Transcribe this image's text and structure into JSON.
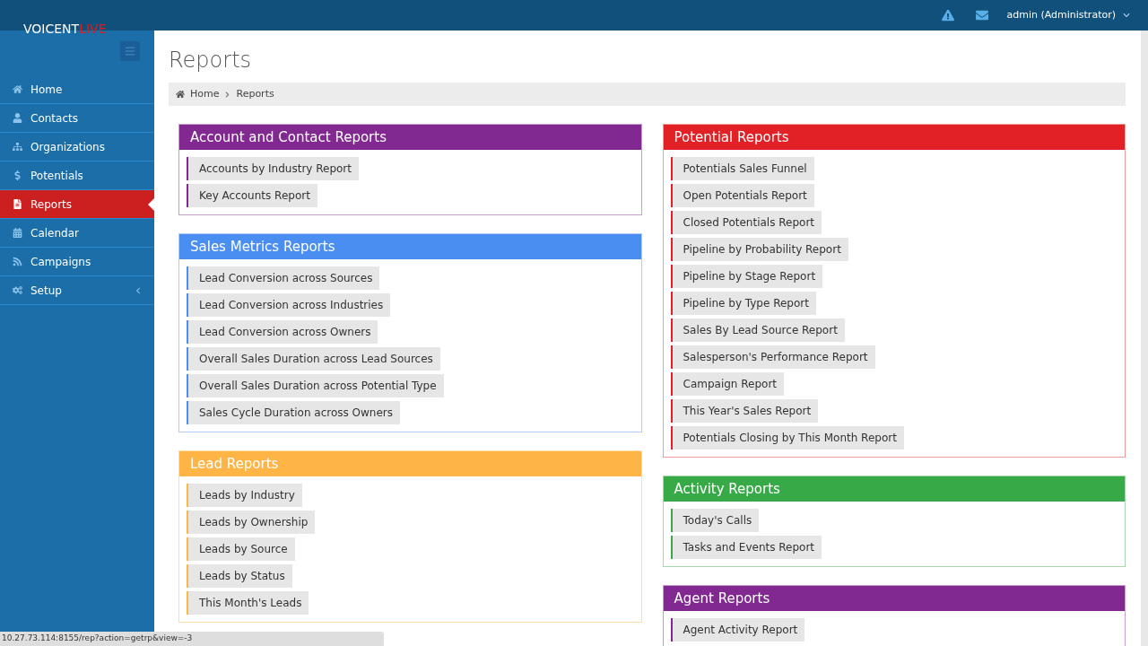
{
  "topbar": {
    "logo_main": "VOICENT",
    "logo_accent": "LIVE",
    "user": "admin (Administrator)"
  },
  "sidebar": {
    "items": [
      {
        "label": "Home",
        "selected": false,
        "submenu": false
      },
      {
        "label": "Contacts",
        "selected": false,
        "submenu": false
      },
      {
        "label": "Organizations",
        "selected": false,
        "submenu": false
      },
      {
        "label": "Potentials",
        "selected": false,
        "submenu": false
      },
      {
        "label": "Reports",
        "selected": true,
        "submenu": false
      },
      {
        "label": "Calendar",
        "selected": false,
        "submenu": false
      },
      {
        "label": "Campaigns",
        "selected": false,
        "submenu": false
      },
      {
        "label": "Setup",
        "selected": false,
        "submenu": true
      }
    ]
  },
  "page_title": "Reports",
  "breadcrumb": [
    "Home",
    "Reports"
  ],
  "columns": [
    [
      {
        "title": "Account and Contact Reports",
        "color": "#812990",
        "items": [
          "Accounts by Industry Report",
          "Key Accounts Report"
        ]
      },
      {
        "title": "Sales Metrics Reports",
        "color": "#4b8ef1",
        "items": [
          "Lead Conversion across Sources",
          "Lead Conversion across Industries",
          "Lead Conversion across Owners",
          "Overall Sales Duration across Lead Sources",
          "Overall Sales Duration across Potential Type",
          "Sales Cycle Duration across Owners"
        ]
      },
      {
        "title": "Lead Reports",
        "color": "#ffb545",
        "items": [
          "Leads by Industry",
          "Leads by Ownership",
          "Leads by Source",
          "Leads by Status",
          "This Month's Leads"
        ]
      }
    ],
    [
      {
        "title": "Potential Reports",
        "color": "#e22126",
        "items": [
          "Potentials Sales Funnel",
          "Open Potentials Report",
          "Closed Potentials Report",
          "Pipeline by Probability Report",
          "Pipeline by Stage Report",
          "Pipeline by Type Report",
          "Sales By Lead Source Report",
          "Salesperson's Performance Report",
          "Campaign Report",
          "This Year's Sales Report",
          "Potentials Closing by This Month Report"
        ]
      },
      {
        "title": "Activity Reports",
        "color": "#38a947",
        "items": [
          "Today's Calls",
          "Tasks and Events Report"
        ]
      },
      {
        "title": "Agent Reports",
        "color": "#812990",
        "items": [
          "Agent Activity Report"
        ]
      }
    ]
  ],
  "status_bar": "10.27.73.114:8155/rep?action=getrp&view=-3"
}
